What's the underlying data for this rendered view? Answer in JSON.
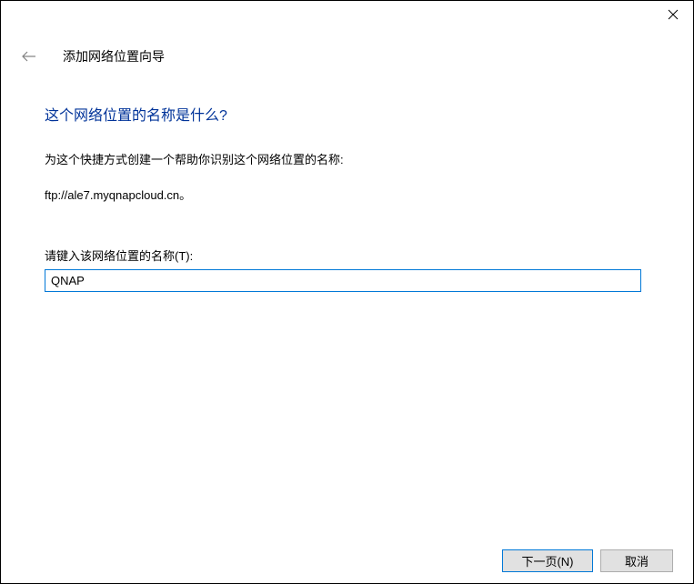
{
  "titlebar": {
    "close_label": "Close"
  },
  "header": {
    "wizard_title": "添加网络位置向导"
  },
  "content": {
    "heading": "这个网络位置的名称是什么?",
    "description": "为这个快捷方式创建一个帮助你识别这个网络位置的名称:",
    "url_text": "ftp://ale7.myqnapcloud.cn。",
    "input_label": "请键入该网络位置的名称(T):",
    "input_value": "QNAP"
  },
  "footer": {
    "next_label": "下一页(N)",
    "cancel_label": "取消"
  }
}
